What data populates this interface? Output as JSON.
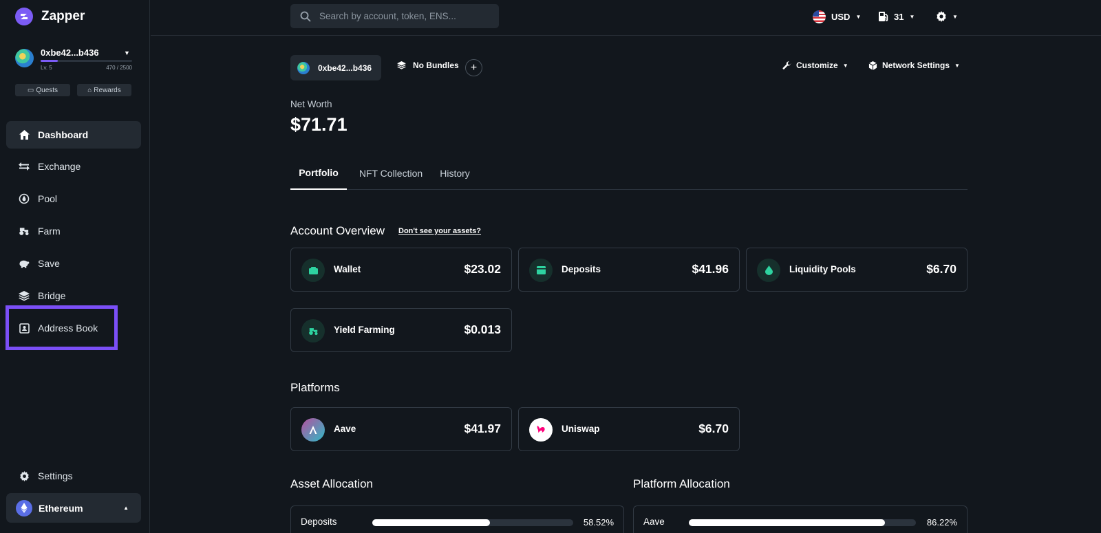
{
  "brand": {
    "name": "Zapper"
  },
  "account": {
    "address": "0xbe42...b436",
    "level": "Lv. 5",
    "xp": "470 / 2500",
    "xp_fraction": 0.188
  },
  "sidebar": {
    "quests_label": "Quests",
    "rewards_label": "Rewards",
    "items": [
      {
        "label": "Dashboard",
        "icon": "home-icon"
      },
      {
        "label": "Exchange",
        "icon": "swap-arrows-icon"
      },
      {
        "label": "Pool",
        "icon": "drop-icon"
      },
      {
        "label": "Farm",
        "icon": "tractor-icon"
      },
      {
        "label": "Save",
        "icon": "piggy-bank-icon"
      },
      {
        "label": "Bridge",
        "icon": "layers-icon"
      },
      {
        "label": "Address Book",
        "icon": "address-book-icon"
      }
    ],
    "settings_label": "Settings",
    "network_label": "Ethereum"
  },
  "topbar": {
    "search_placeholder": "Search by account, token, ENS...",
    "currency": "USD",
    "gas": "31"
  },
  "main": {
    "wallet_chip": "0xbe42...b436",
    "bundles_label": "No Bundles",
    "customize_label": "Customize",
    "network_settings_label": "Network Settings",
    "net_worth_label": "Net Worth",
    "net_worth_value": "$71.71",
    "tabs": [
      "Portfolio",
      "NFT Collection",
      "History"
    ],
    "account_overview_title": "Account Overview",
    "dont_see_assets": "Don't see your assets?",
    "overview_cards": [
      {
        "label": "Wallet",
        "value": "$23.02",
        "icon": "wallet-icon"
      },
      {
        "label": "Deposits",
        "value": "$41.96",
        "icon": "bank-icon"
      },
      {
        "label": "Liquidity Pools",
        "value": "$6.70",
        "icon": "drop-icon"
      },
      {
        "label": "Yield Farming",
        "value": "$0.013",
        "icon": "tractor-icon"
      }
    ],
    "platforms_title": "Platforms",
    "platforms": [
      {
        "label": "Aave",
        "value": "$41.97",
        "icon": "aave-logo-icon"
      },
      {
        "label": "Uniswap",
        "value": "$6.70",
        "icon": "uniswap-logo-icon"
      }
    ],
    "asset_allocation_title": "Asset Allocation",
    "platform_allocation_title": "Platform Allocation",
    "asset_allocation": [
      {
        "label": "Deposits",
        "pct": "58.52%",
        "fraction": 0.5852
      }
    ],
    "platform_allocation": [
      {
        "label": "Aave",
        "pct": "86.22%",
        "fraction": 0.8622
      }
    ]
  },
  "colors": {
    "accent": "#7b5cf5",
    "highlight": "#7b4ff7",
    "green": "#2ed3a0",
    "background": "#12171d",
    "card_border": "#323a44"
  }
}
